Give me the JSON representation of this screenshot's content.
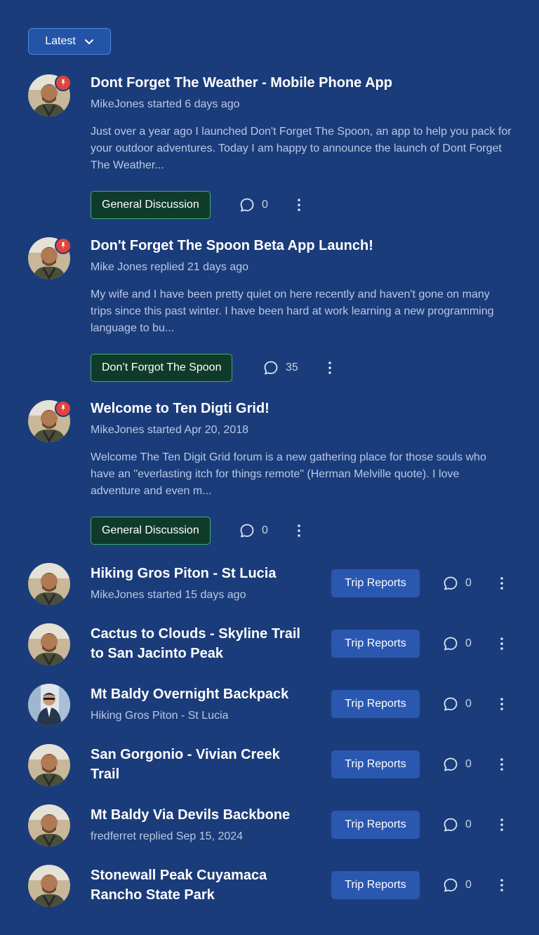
{
  "sort": {
    "label": "Latest"
  },
  "pinned_topics": [
    {
      "title": "Dont Forget The Weather - Mobile Phone App",
      "meta": "MikeJones started 6 days ago",
      "excerpt": "Just over a year ago I launched Don't Forget The Spoon, an app to help you pack for your outdoor adventures. Today I am happy to announce the launch of Dont Forget The Weather...",
      "category": "General Discussion",
      "comments": "0"
    },
    {
      "title": "Don't Forget The Spoon Beta App Launch!",
      "meta": "Mike Jones replied 21 days ago",
      "excerpt": "My wife and I have been pretty quiet on here recently and haven't gone on many trips since this past winter. I have been hard at work learning a new programming language to bu...",
      "category": "Don’t Forgot The Spoon",
      "comments": "35"
    },
    {
      "title": "Welcome to Ten Digti Grid!",
      "meta": "MikeJones started Apr 20, 2018",
      "excerpt": "Welcome The Ten Digit Grid forum is a new gathering place for those souls who have an \"everlasting itch for things remote\" (Herman Melville quote). I love adventure and even m...",
      "category": "General Discussion",
      "comments": "0"
    }
  ],
  "topics": [
    {
      "title_lines": [
        "Hiking Gros Piton - St Lucia"
      ],
      "meta": "MikeJones started 15 days ago",
      "category": "Trip Reports",
      "comments": "0"
    },
    {
      "title_lines": [
        "Cactus to Clouds - Skyline Trail",
        "to San Jacinto Peak"
      ],
      "meta": "",
      "category": "Trip Reports",
      "comments": "0"
    },
    {
      "title_lines": [
        "Mt Baldy Overnight Backpack"
      ],
      "meta": "Hiking Gros Piton - St Lucia",
      "category": "Trip Reports",
      "comments": "0"
    },
    {
      "title_lines": [
        "San Gorgonio - Vivian Creek",
        "Trail"
      ],
      "meta": "",
      "category": "Trip Reports",
      "comments": "0"
    },
    {
      "title_lines": [
        "Mt Baldy Via Devils Backbone"
      ],
      "meta": "fredferret replied Sep 15, 2024",
      "category": "Trip Reports",
      "comments": "0"
    },
    {
      "title_lines": [
        "Stonewall Peak Cuyamaca",
        "Rancho State Park"
      ],
      "meta": "",
      "category": "Trip Reports",
      "comments": "0"
    }
  ],
  "colors": {
    "background": "#1b3c7a",
    "pin": "#e0443c",
    "category_green_bg": "#0f3b2a",
    "category_blue_bg": "#2a58b0",
    "muted_text": "#b9c8e6"
  },
  "icons": {
    "sort": "chevron-down-icon",
    "pin": "pin-icon",
    "comments": "comment-bubble-icon",
    "menu": "kebab-menu-icon"
  }
}
